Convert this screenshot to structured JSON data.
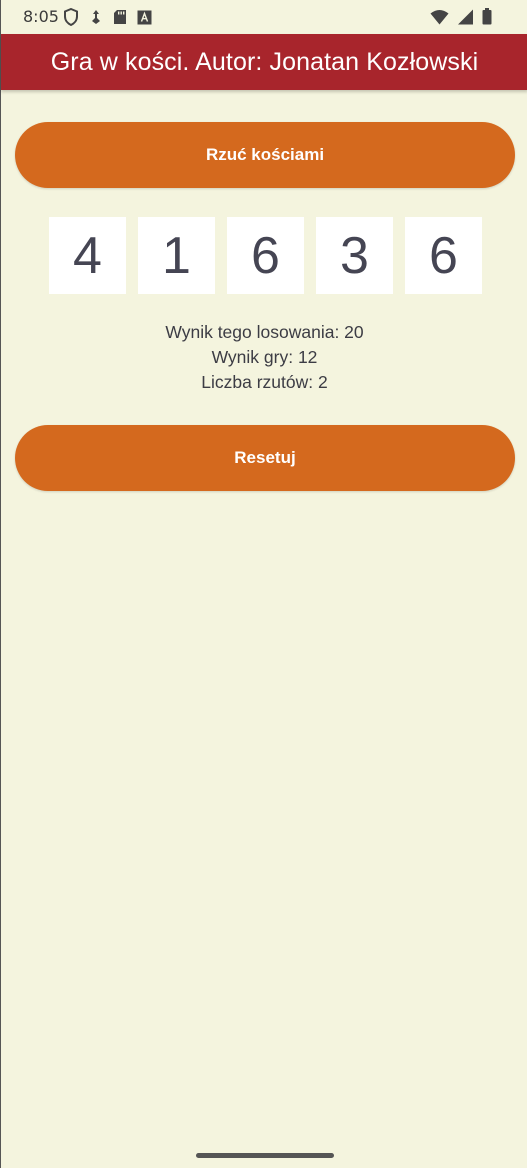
{
  "status_bar": {
    "time": "8:05",
    "left_icons": [
      "shield-icon",
      "usb-debug-icon",
      "sd-card-icon",
      "keyboard-icon"
    ],
    "right_icons": [
      "wifi-icon",
      "cell-signal-icon",
      "battery-icon"
    ]
  },
  "app_bar": {
    "title": "Gra w kości. Autor: Jonatan Kozłowski",
    "color": "#a8252c"
  },
  "buttons": {
    "roll_label": "Rzuć kościami",
    "reset_label": "Resetuj",
    "color": "#d4691e"
  },
  "dice": {
    "values": [
      4,
      1,
      6,
      3,
      6
    ]
  },
  "stats": {
    "roll_result": "Wynik tego losowania: 20",
    "game_result": "Wynik gry: 12",
    "roll_count": "Liczba rzutów: 2"
  }
}
